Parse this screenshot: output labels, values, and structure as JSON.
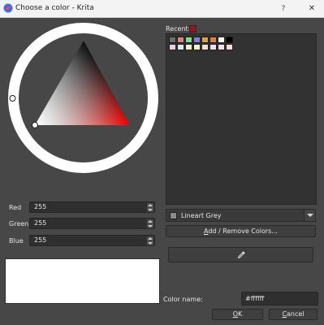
{
  "window": {
    "title": "Choose a color - Krita",
    "help_glyph": "?",
    "close_glyph": "✕",
    "app_icon": "krita-icon"
  },
  "rgb": {
    "red_label": "Red",
    "red_value": "255",
    "green_label": "Green",
    "green_value": "255",
    "blue_label": "Blue",
    "blue_value": "255"
  },
  "preview_color": "#ffffff",
  "recent": {
    "label": "Recent:",
    "swatch_color": "#8b1a1a"
  },
  "palette": {
    "swatches_row1": [
      "#6e6e6e",
      "#e08080",
      "#80e080",
      "#8080e0",
      "#e0a040",
      "#e08040",
      "#ffffff",
      "#000000"
    ],
    "swatches_row2": [
      "#f0c8e8",
      "#d8e8f8",
      "#fff0c8",
      "#f0f8c8",
      "#f8e0d0",
      "#e8e0f0",
      "#ffe0e0",
      "#ffd8d8"
    ],
    "selected_palette": "Lineart Grey",
    "add_remove_label_prefix": "A",
    "add_remove_label_rest": "dd / Remove Colors..."
  },
  "eyedropper_icon": "eyedropper-icon",
  "color_name": {
    "label": "Color name:",
    "value": "#ffffff"
  },
  "buttons": {
    "ok_u": "O",
    "ok_rest": "K",
    "cancel_u": "C",
    "cancel_rest": "ancel"
  },
  "selector_hue": "#ff0000"
}
